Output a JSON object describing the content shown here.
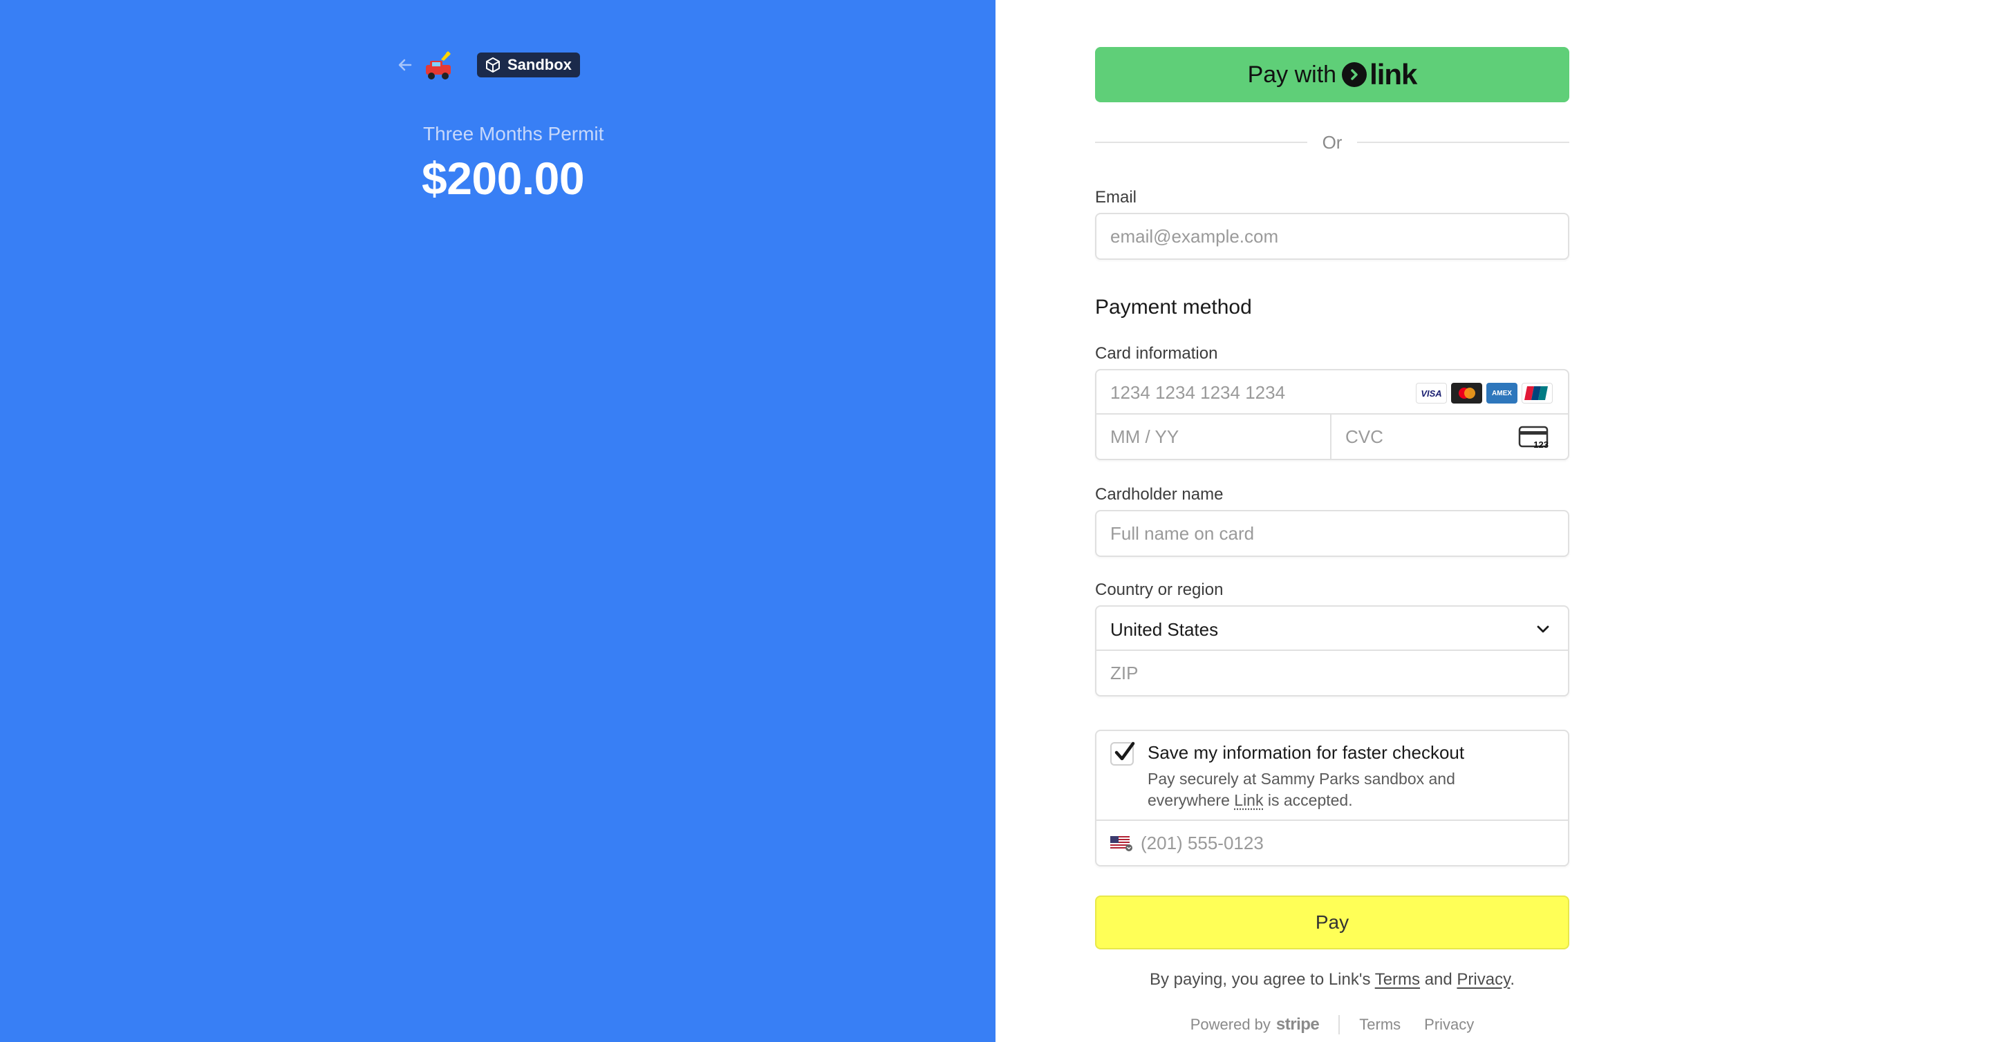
{
  "merchant": {
    "sandbox_label": "Sandbox",
    "product_name": "Three Months Permit",
    "amount": "$200.00"
  },
  "link_button": {
    "prefix": "Pay with",
    "brand": "link"
  },
  "divider_text": "Or",
  "email": {
    "label": "Email",
    "placeholder": "email@example.com"
  },
  "payment": {
    "section_title": "Payment method",
    "card_label": "Card information",
    "card_placeholder": "1234 1234 1234 1234",
    "exp_placeholder": "MM / YY",
    "cvc_placeholder": "CVC",
    "cvc_icon_text": "123",
    "brands": [
      "VISA",
      "mastercard",
      "AMEX",
      "UnionPay"
    ]
  },
  "cardholder": {
    "label": "Cardholder name",
    "placeholder": "Full name on card"
  },
  "country": {
    "label": "Country or region",
    "selected": "United States",
    "zip_placeholder": "ZIP"
  },
  "save_info": {
    "checked": true,
    "title": "Save my information for faster checkout",
    "desc_before": "Pay securely at Sammy Parks sandbox and everywhere ",
    "desc_link": "Link",
    "desc_after": " is accepted.",
    "phone_placeholder": "(201) 555-0123"
  },
  "pay_button": "Pay",
  "terms": {
    "before": "By paying, you agree to Link's ",
    "terms_link": "Terms",
    "middle": " and ",
    "privacy_link": "Privacy",
    "after": "."
  },
  "footer": {
    "powered_by": "Powered by",
    "stripe": "stripe",
    "terms": "Terms",
    "privacy": "Privacy"
  },
  "colors": {
    "left_panel": "#387ff5",
    "link_green": "#5fcf78",
    "pay_yellow": "#ffff57"
  }
}
